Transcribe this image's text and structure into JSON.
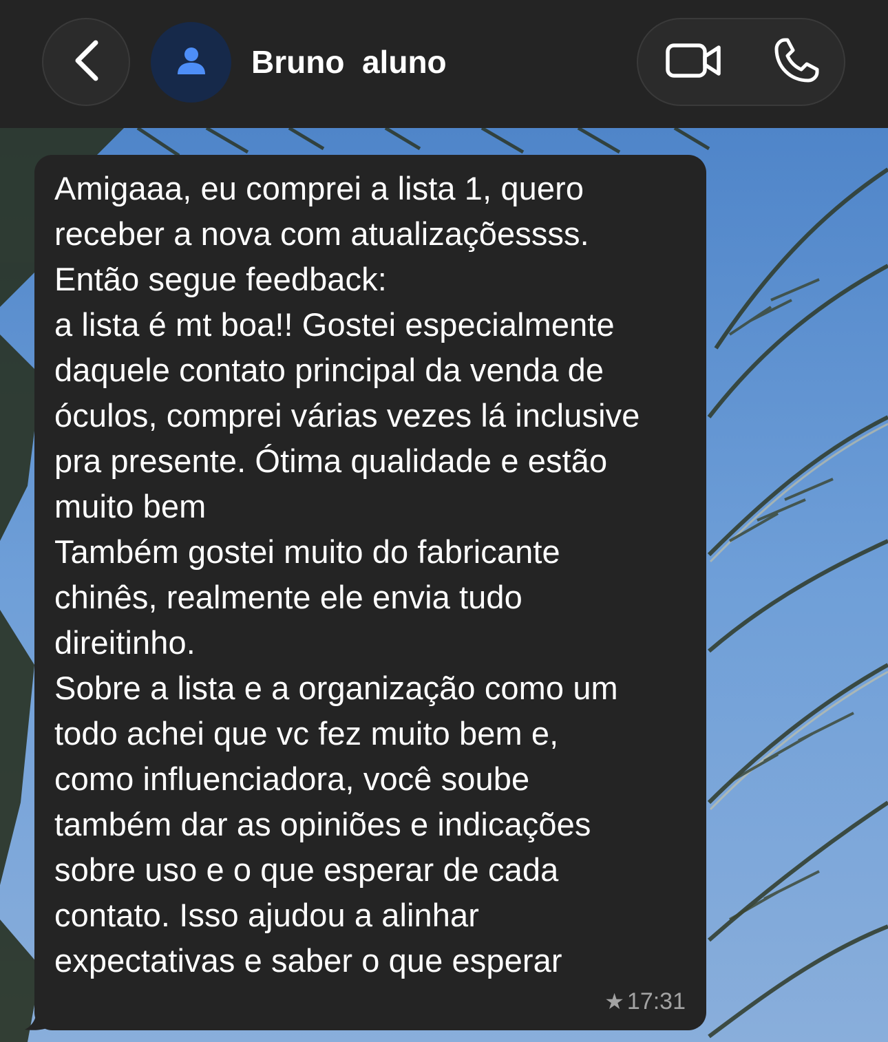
{
  "header": {
    "contact_name": "Bruno  aluno"
  },
  "message": {
    "text": "Amigaaa, eu comprei a lista 1, quero\nreceber a nova com atualizaçõessss.\nEntão segue feedback:\na lista é mt boa!! Gostei especialmente\ndaquele contato principal da venda de\nóculos, comprei várias vezes lá inclusive\npra presente. Ótima qualidade e estão\nmuito bem\nTambém gostei muito do fabricante\nchinês, realmente ele envia tudo\ndireitinho.\nSobre a lista e a organização como um\ntodo achei que vc fez muito bem e,\ncomo influenciadora, você soube\ntambém dar as opiniões e indicações\nsobre uso e o que esperar de cada\ncontato. Isso ajudou a alinhar\nexpectativas e saber o que esperar",
    "star_icon": "★",
    "time": "17:31"
  },
  "icons": {
    "back": "chevron-left-icon",
    "avatar": "person-icon",
    "video": "video-camera-icon",
    "phone": "phone-icon",
    "star": "star-icon"
  },
  "colors": {
    "header_bg": "#242424",
    "bubble_bg": "#242424",
    "avatar_bg": "#16294a",
    "avatar_fg": "#4e8ef7",
    "text": "#ffffff",
    "meta": "#a3a3a3"
  }
}
